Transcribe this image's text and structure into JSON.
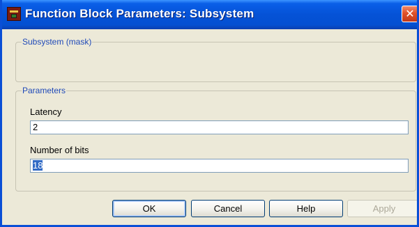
{
  "window": {
    "title": "Function Block Parameters: Subsystem",
    "close_glyph": "✕",
    "app_icon": "simulink-block-icon",
    "colors": {
      "titlebar": "#0552d6",
      "frame": "#0a4fd6",
      "face": "#ece9d8",
      "close": "#e0522a",
      "group_legend": "#1f49b8",
      "selection": "#316ac5"
    }
  },
  "mask_group": {
    "legend": "Subsystem (mask)"
  },
  "parameters_group": {
    "legend": "Parameters",
    "latency": {
      "label": "Latency",
      "value": "2"
    },
    "num_bits": {
      "label": "Number of bits",
      "value": "18",
      "selected": true
    }
  },
  "buttons": {
    "ok": "OK",
    "cancel": "Cancel",
    "help": "Help",
    "apply": "Apply",
    "apply_enabled": false
  }
}
